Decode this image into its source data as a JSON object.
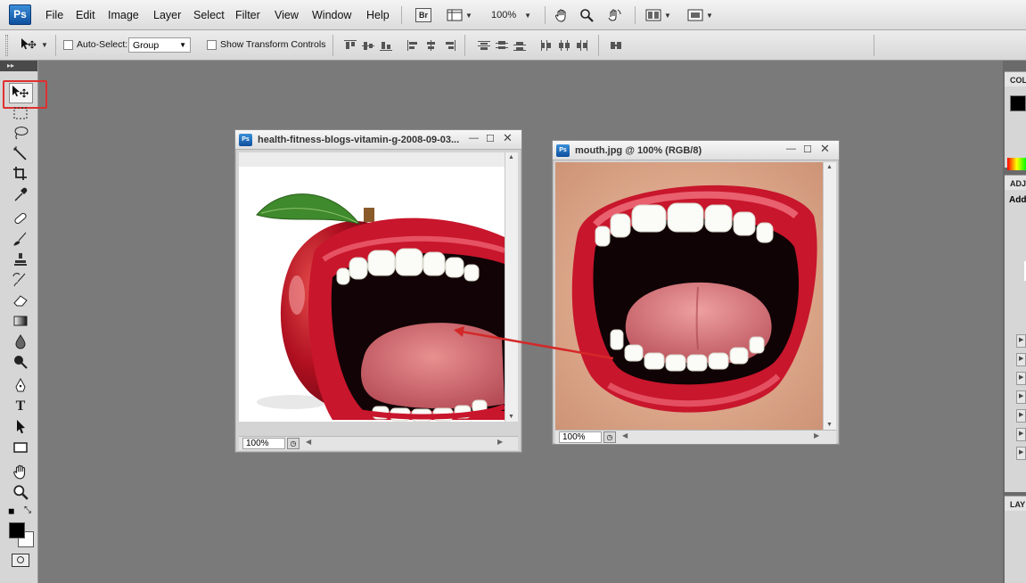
{
  "app": {
    "logo": "Ps"
  },
  "menu": [
    "File",
    "Edit",
    "Image",
    "Layer",
    "Select",
    "Filter",
    "View",
    "Window",
    "Help"
  ],
  "menubar_tools": {
    "bridge_label": "Br",
    "zoom_value": "100%",
    "icons": [
      "hand-icon",
      "zoom-icon",
      "rotate-view-icon",
      "arrange-documents-icon",
      "screen-mode-icon"
    ]
  },
  "options": {
    "auto_select_label": "Auto-Select:",
    "auto_select_value": "Group",
    "show_transform_label": "Show Transform Controls"
  },
  "tools": [
    "move-tool",
    "marquee-tool",
    "lasso-tool",
    "magic-wand-tool",
    "crop-tool",
    "eyedropper-tool",
    "healing-brush-tool",
    "brush-tool",
    "clone-stamp-tool",
    "history-brush-tool",
    "eraser-tool",
    "gradient-tool",
    "blur-tool",
    "dodge-tool",
    "pen-tool",
    "type-tool",
    "path-selection-tool",
    "shape-tool",
    "hand-tool",
    "zoom-tool"
  ],
  "swatches": {
    "foreground": "#000000",
    "background": "#ffffff"
  },
  "documents": [
    {
      "title": "health-fitness-blogs-vitamin-g-2008-09-03...",
      "zoom": "100%"
    },
    {
      "title": "mouth.jpg @ 100% (RGB/8)",
      "zoom": "100%"
    }
  ],
  "panels": {
    "color_tab": "COL",
    "adjustments_tab": "ADJ",
    "adjustments_sub": "Add",
    "layers_tab": "LAY"
  },
  "colors": {
    "highlight": "#e03030",
    "lip_red": "#c8162c"
  }
}
